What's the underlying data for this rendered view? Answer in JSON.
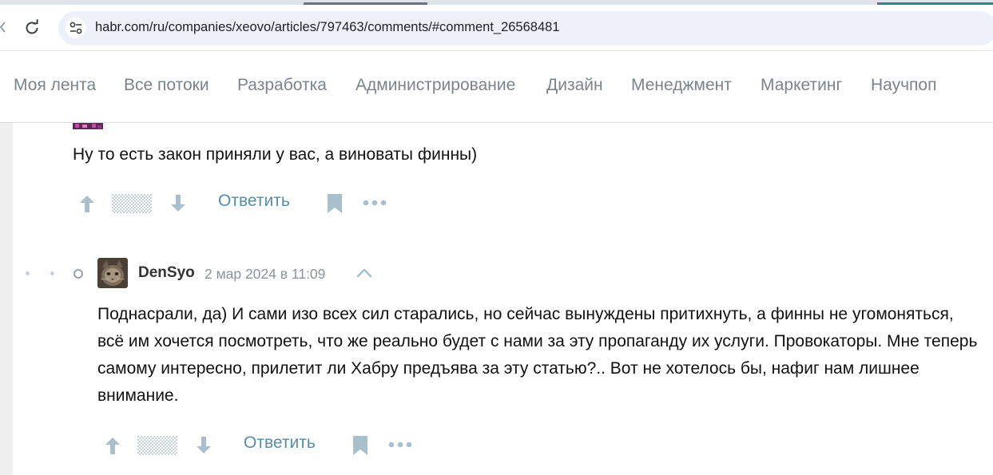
{
  "browser": {
    "url": "habr.com/ru/companies/xeovo/articles/797463/comments/#comment_26568481"
  },
  "site_nav": {
    "items": [
      "Моя лента",
      "Все потоки",
      "Разработка",
      "Администрирование",
      "Дизайн",
      "Менеджмент",
      "Маркетинг",
      "Научпоп"
    ]
  },
  "comments": [
    {
      "text": "Ну то есть закон приняли у вас, а виноваты финны)",
      "reply_label": "Ответить"
    },
    {
      "author": "DenSyo",
      "date": "2 мар 2024 в 11:09",
      "text": "Поднасрали, да) И сами изо всех сил старались, но сейчас вынуждены притихнуть, а финны не угомоняться, всё им хочется посмотреть, что же реально будет с нами за эту пропаганду их услуги. Провокаторы. Мне теперь самому интересно, прилетит ли Хабру предъява за эту статью?.. Вот не хотелось бы, нафиг нам лишнее внимание.",
      "reply_label": "Ответить"
    }
  ],
  "icons": {
    "reload": "reload-icon",
    "site_info": "site-info-icon",
    "upvote": "arrow-up-icon",
    "downvote": "arrow-down-icon",
    "bookmark": "bookmark-icon",
    "more": "more-icon",
    "collapse": "chevron-up-icon"
  },
  "colors": {
    "link": "#548eaa",
    "vote_icons": "#a9c0cc",
    "nav_text": "#7b848c"
  }
}
